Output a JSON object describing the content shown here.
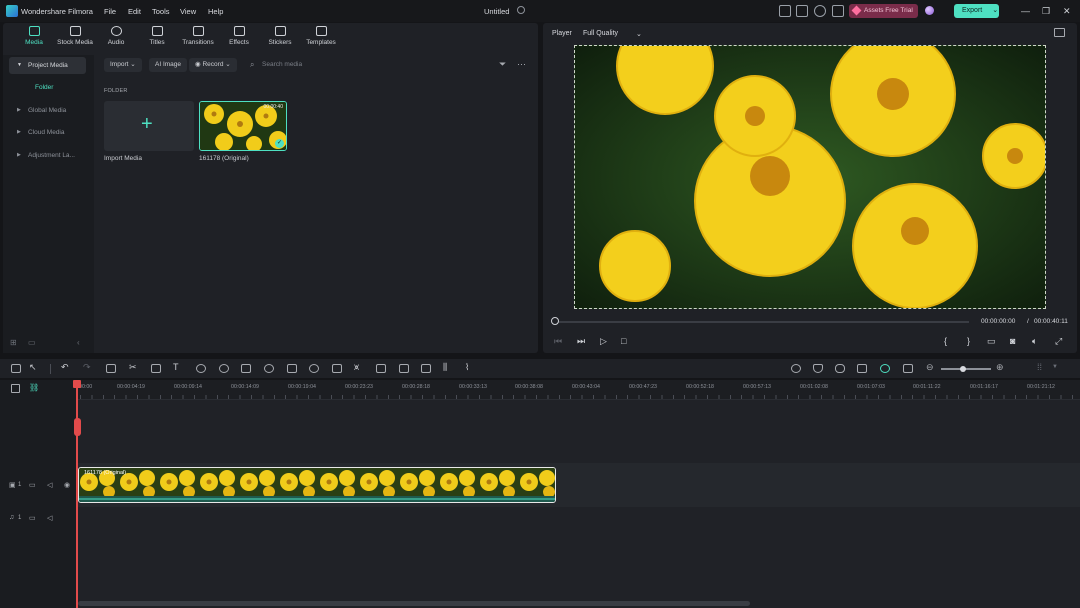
{
  "app": {
    "name": "Wondershare Filmora",
    "document_title": "Untitled"
  },
  "menu": [
    "File",
    "Edit",
    "Tools",
    "View",
    "Help"
  ],
  "header": {
    "assets_label": "Assets Free Trial",
    "export_label": "Export",
    "accent": "#4ee0c2"
  },
  "tabs": [
    {
      "label": "Media",
      "icon": "media-icon",
      "active": true
    },
    {
      "label": "Stock Media",
      "icon": "stock-media-icon"
    },
    {
      "label": "Audio",
      "icon": "music-note-icon"
    },
    {
      "label": "Titles",
      "icon": "text-icon"
    },
    {
      "label": "Transitions",
      "icon": "transitions-icon"
    },
    {
      "label": "Effects",
      "icon": "effects-icon"
    },
    {
      "label": "Stickers",
      "icon": "stickers-icon"
    },
    {
      "label": "Templates",
      "icon": "templates-icon"
    }
  ],
  "sidebar": {
    "items": [
      "Project Media",
      "Global Media",
      "Cloud Media",
      "Adjustment La..."
    ],
    "folder": "Folder"
  },
  "media_toolbar": {
    "import": "Import",
    "ai_image": "AI Image",
    "record": "Record",
    "search_placeholder": "Search media"
  },
  "media": {
    "folder_label": "FOLDER",
    "import_label": "Import Media",
    "clip_label": "161178 (Original)",
    "clip_duration": "00:00:40"
  },
  "player": {
    "label": "Player",
    "quality": "Full Quality",
    "current_time": "00:00:00:00",
    "separator": "/",
    "total_time": "00:00:40:11"
  },
  "timeline": {
    "ruler": [
      "00:00",
      "00:00:04:19",
      "00:00:09:14",
      "00:00:14:09",
      "00:00:19:04",
      "00:00:23:23",
      "00:00:28:18",
      "00:00:33:13",
      "00:00:38:08",
      "00:00:43:04",
      "00:00:47:23",
      "00:00:52:18",
      "00:00:57:13",
      "00:01:02:08",
      "00:01:07:03",
      "00:01:11:22",
      "00:01:16:17",
      "00:01:21:12"
    ],
    "video_track_num": "1",
    "audio_track_num": "1",
    "clip_label": "161178 (Original)"
  }
}
